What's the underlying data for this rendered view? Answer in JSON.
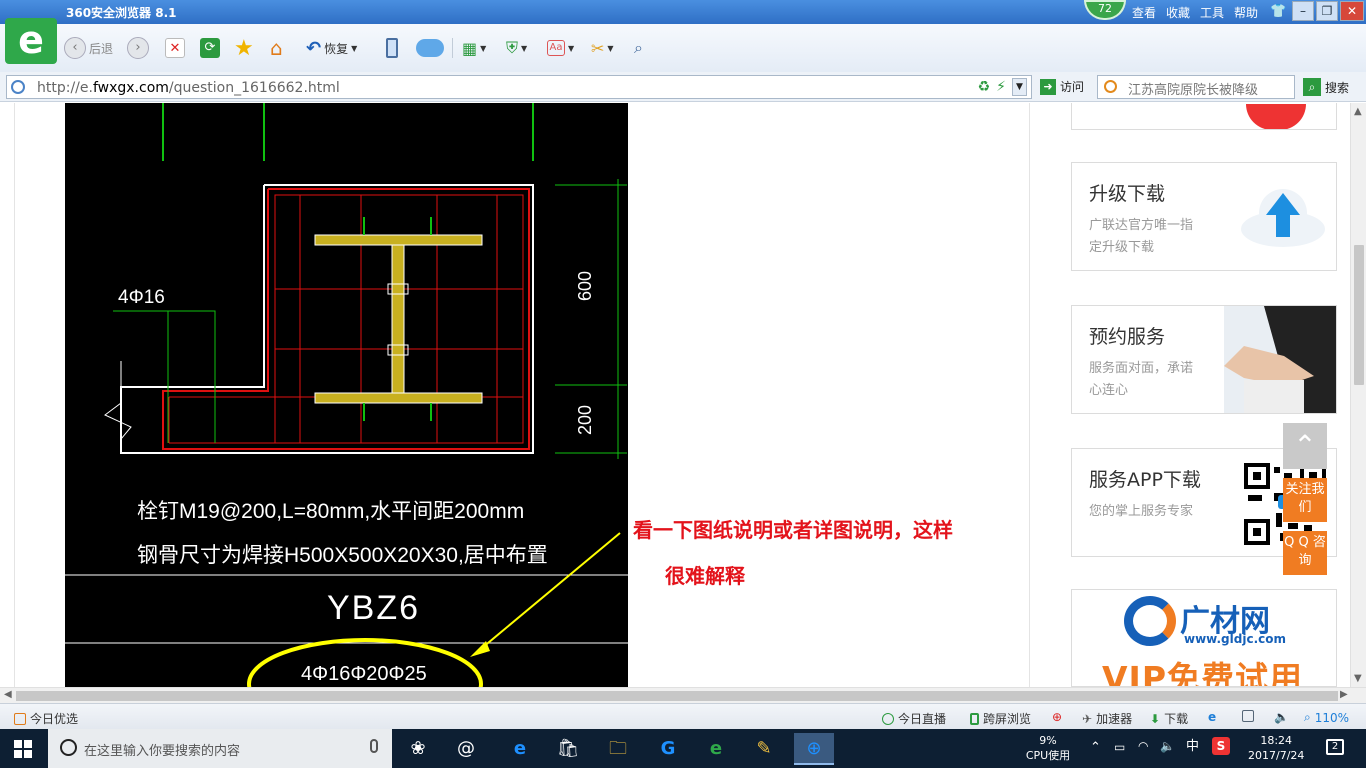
{
  "browser": {
    "title": "360安全浏览器 8.1",
    "score": "72",
    "menus": [
      "查看",
      "收藏",
      "工具",
      "帮助"
    ],
    "back_label": "后退",
    "restore_label": "恢复",
    "url_prefix": "http://e.",
    "url_domain": "fwxgx.com",
    "url_path": "/question_1616662.html",
    "goto_label": "访问",
    "search_text": "江苏高院原院长被降级",
    "search_label": "搜索"
  },
  "drawing": {
    "label_4phi16": "4Φ16",
    "dim_600": "600",
    "dim_200": "200",
    "caption_line1": "栓钉M19@200,L=80mm,水平间距200mm",
    "caption_line2": "钢骨尺寸为焊接H500X500X20X30,居中布置",
    "ybz": "YBZ6",
    "rebar": "4Φ16Φ20Φ25"
  },
  "annotation": {
    "line1": "看一下图纸说明或者详图说明，这样",
    "line2": "很难解释"
  },
  "sidebar": {
    "cards": [
      {
        "title": "升级下载",
        "desc": "广联达官方唯一指定升级下载"
      },
      {
        "title": "预约服务",
        "desc": "服务面对面，承诺心连心"
      },
      {
        "title": "服务APP下载",
        "desc": "您的掌上服务专家"
      }
    ],
    "follow_label": "关注我们",
    "qq_label": "Q Q 咨询",
    "ad_brand": "广材网",
    "ad_site": "www.gldjc.com",
    "ad_vip": "VIP免费试用"
  },
  "statusbar": {
    "today_pick": "今日优选",
    "live": "今日直播",
    "cross_screen": "跨屏浏览",
    "accelerator": "加速器",
    "download": "下载",
    "zoom": "110%"
  },
  "taskbar": {
    "search_placeholder": "在这里输入你要搜索的内容",
    "cpu_percent": "9%",
    "cpu_label": "CPU使用",
    "ime": "中",
    "time": "18:24",
    "date": "2017/7/24",
    "notifications": "2"
  },
  "colors": {
    "title_blue": "#2f6fc5",
    "annotation_red": "#e3131b",
    "accent_orange": "#f07c22",
    "cad_red": "#e01010",
    "cad_green": "#10c010",
    "highlight_yellow": "#ffff00"
  }
}
